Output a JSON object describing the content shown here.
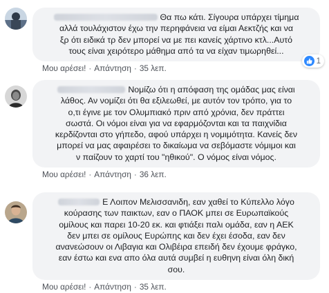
{
  "comments": [
    {
      "lines": [
        "Θα πω κάτι. Σίγουρα υπάρχει τίμημα",
        "αλλά τουλάχιστον έχω την περηφάνεια να είμαι Αεκτζής και να",
        "ξρ ότι ειδικά τρ δεν μπορεί να με πει κανείς χάρτινο κτλ...Αυτό",
        "τους είναι χειρότερο μάθημα από τα να είχαν τιμωρηθεί..."
      ],
      "like_label": "Μου αρέσει!",
      "reply_label": "Απάντηση",
      "time": "35 λεπ.",
      "reaction_count": "1",
      "reaction_icon": "like-icon"
    },
    {
      "lines": [
        "Νομίζω ότι η απόφαση της ομάδας μας είναι",
        "λάθος. Αν νομίζει ότι θα εξιλεωθεί, με αυτόν τον τρόπο, για το",
        "ο,τι έγινε με τον Ολυμπιακό πριν από χρόνια, δεν πράττει",
        "σωστά. Οι νόμοι είναι για να εφαρμόζονται και τα παιχνίδια",
        "κερδίζονται στο γήπεδο, αφού υπάρχει η νομιμότητα. Κανείς δεν",
        "μπορεί να μας αφαιρέσει το δικαίωμα να σεβόμαστε νόμιμοι και",
        "ν παίζουν το χαρτί του \"ηθικού\". Ο νόμος είναι νόμος."
      ],
      "like_label": "Μου αρέσει!",
      "reply_label": "Απάντηση",
      "time": "36 λεπ."
    },
    {
      "lines": [
        "Ε Λοιπον Μελισσανιδη, εαν χαθεί το Κύπελλο λόγο",
        "κούρασης των παικτων, εαν ο ΠΑΟΚ μπει σε Ευρωπαϊκούς",
        "ομίλους και παρει 10-20 εκ. και φτιάξει παλι ομάδα, εαν η ΑΕΚ",
        "δεν μπει σε ομίλους Ευρώπης και δεν έχει έσοδα, εαν δεν",
        "ανανεώσουν οι Λιβαγια και Ολιβέιρα επειδή δεν έχουμε φράγκο,",
        "εαν έστω και ενα απο όλα αυτά συμβεί η ευθηνη είναι όλη δική",
        "σου."
      ],
      "like_label": "Μου αρέσει!",
      "reply_label": "Απάντηση",
      "time": "35 λεπ."
    }
  ],
  "colors": {
    "bubble": "#f2f3f5",
    "action_text": "#606770",
    "like_blue": "#2e89ff"
  }
}
